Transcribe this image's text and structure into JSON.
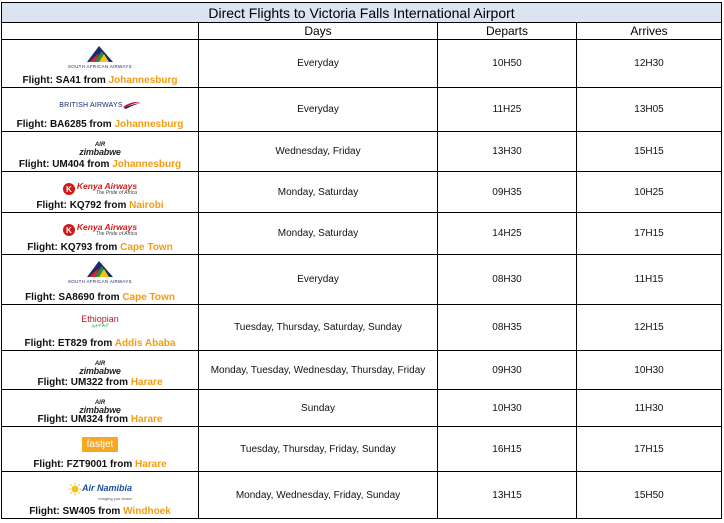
{
  "title": "Direct Flights to Victoria Falls International Airport",
  "headers": {
    "flight": "",
    "days": "Days",
    "departs": "Departs",
    "arrives": "Arrives"
  },
  "colors": {
    "title_bg": "#dbe4f1",
    "city": "#f39c12"
  },
  "rows": [
    {
      "logo": "south-african-airways",
      "logo_text": "SOUTH AFRICAN AIRWAYS",
      "prefix": "Flight: SA41 from ",
      "city": "Johannesburg",
      "days": "Everyday",
      "departs": "10H50",
      "arrives": "12H30"
    },
    {
      "logo": "british-airways",
      "logo_text": "BRITISH AIRWAYS",
      "prefix": "Flight: BA6285 from ",
      "city": "Johannesburg",
      "days": "Everyday",
      "departs": "11H25",
      "arrives": "13H05"
    },
    {
      "logo": "air-zimbabwe",
      "logo_air": "AIR",
      "logo_text": "zimbabwe",
      "prefix": "Flight: UM404 from ",
      "city": "Johannesburg",
      "days": "Wednesday, Friday",
      "departs": "13H30",
      "arrives": "15H15"
    },
    {
      "logo": "kenya-airways",
      "logo_text": "Kenya Airways",
      "logo_tag": "The Pride of Africa",
      "prefix": "Flight: KQ792 from ",
      "city": "Nairobi",
      "days": "Monday, Saturday",
      "departs": "09H35",
      "arrives": "10H25"
    },
    {
      "logo": "kenya-airways",
      "logo_text": "Kenya Airways",
      "logo_tag": "The Pride of Africa",
      "prefix": "Flight: KQ793 from ",
      "city": "Cape Town",
      "days": "Monday, Saturday",
      "departs": "14H25",
      "arrives": "17H15"
    },
    {
      "logo": "south-african-airways",
      "logo_text": "SOUTH AFRICAN AIRWAYS",
      "prefix": "Flight: SA8690 from ",
      "city": "Cape Town",
      "days": "Everyday",
      "departs": "08H30",
      "arrives": "11H15"
    },
    {
      "logo": "ethiopian",
      "logo_text": "Ethiopian",
      "logo_tag": "ኢትዮጵያ",
      "prefix": "Flight: ET829 from ",
      "city": "Addis Ababa",
      "days": "Tuesday, Thursday, Saturday, Sunday",
      "departs": "08H35",
      "arrives": "12H15"
    },
    {
      "logo": "air-zimbabwe",
      "logo_air": "AIR",
      "logo_text": "zimbabwe",
      "prefix": "Flight: UM322 from ",
      "city": "Harare",
      "days": "Monday, Tuesday, Wednesday, Thursday, Friday",
      "departs": "09H30",
      "arrives": "10H30"
    },
    {
      "logo": "air-zimbabwe",
      "logo_air": "AIR",
      "logo_text": "zimbabwe",
      "prefix": "Flight: UM324 from ",
      "city": "Harare",
      "days": "Sunday",
      "departs": "10H30",
      "arrives": "11H30"
    },
    {
      "logo": "fastjet",
      "logo_text": "fastjet",
      "prefix": "Flight: FZT9001 from ",
      "city": "Harare",
      "days": "Tuesday, Thursday, Friday, Sunday",
      "departs": "16H15",
      "arrives": "17H15"
    },
    {
      "logo": "air-namibia",
      "logo_text": "Air Namibia",
      "logo_tag": "bringing you closer",
      "prefix": "Flight: SW405 from ",
      "city": "Windhoek",
      "days": "Monday, Wednesday, Friday, Sunday",
      "departs": "13H15",
      "arrives": "15H50"
    }
  ]
}
